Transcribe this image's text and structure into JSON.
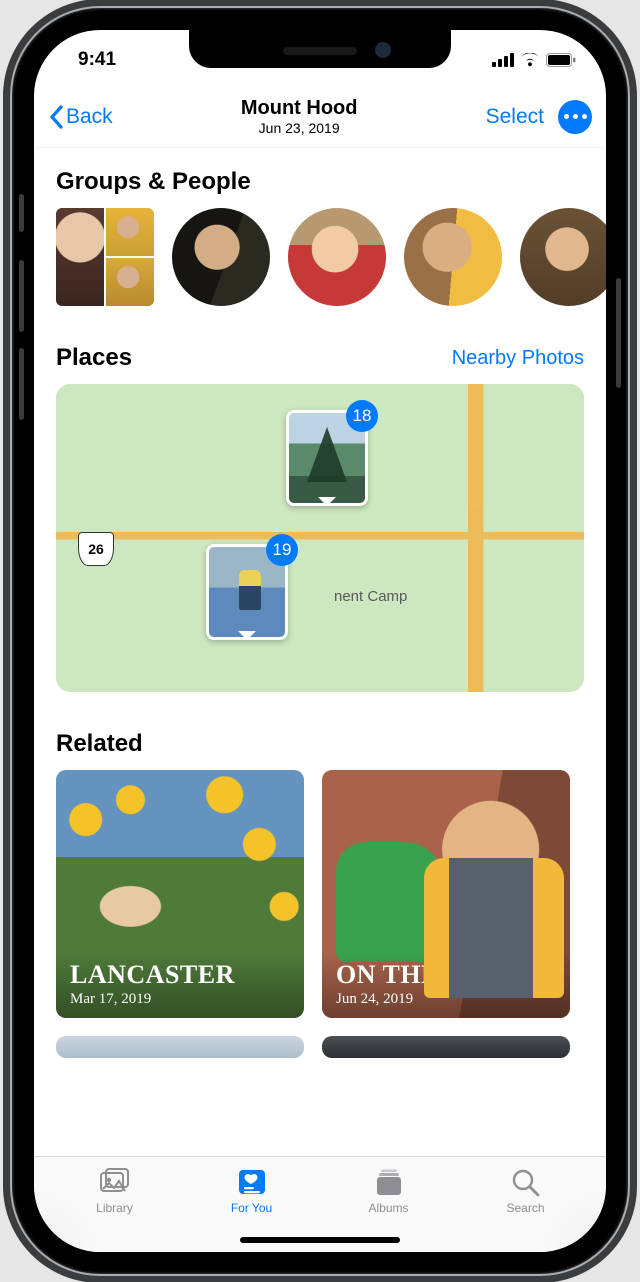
{
  "statusbar": {
    "time": "9:41"
  },
  "navbar": {
    "back_label": "Back",
    "title": "Mount Hood",
    "subtitle": "Jun 23, 2019",
    "select_label": "Select"
  },
  "sections": {
    "people_heading": "Groups & People",
    "places_heading": "Places",
    "places_link": "Nearby Photos",
    "related_heading": "Related"
  },
  "map": {
    "route_shield": "26",
    "visible_label": "nent Camp",
    "pins": [
      {
        "count": "18"
      },
      {
        "count": "19"
      }
    ]
  },
  "related": [
    {
      "title": "LANCASTER",
      "date": "Mar 17, 2019"
    },
    {
      "title": "ON THE TRAIL",
      "date": "Jun 24, 2019"
    }
  ],
  "tabs": {
    "library": "Library",
    "for_you": "For You",
    "albums": "Albums",
    "search": "Search"
  }
}
